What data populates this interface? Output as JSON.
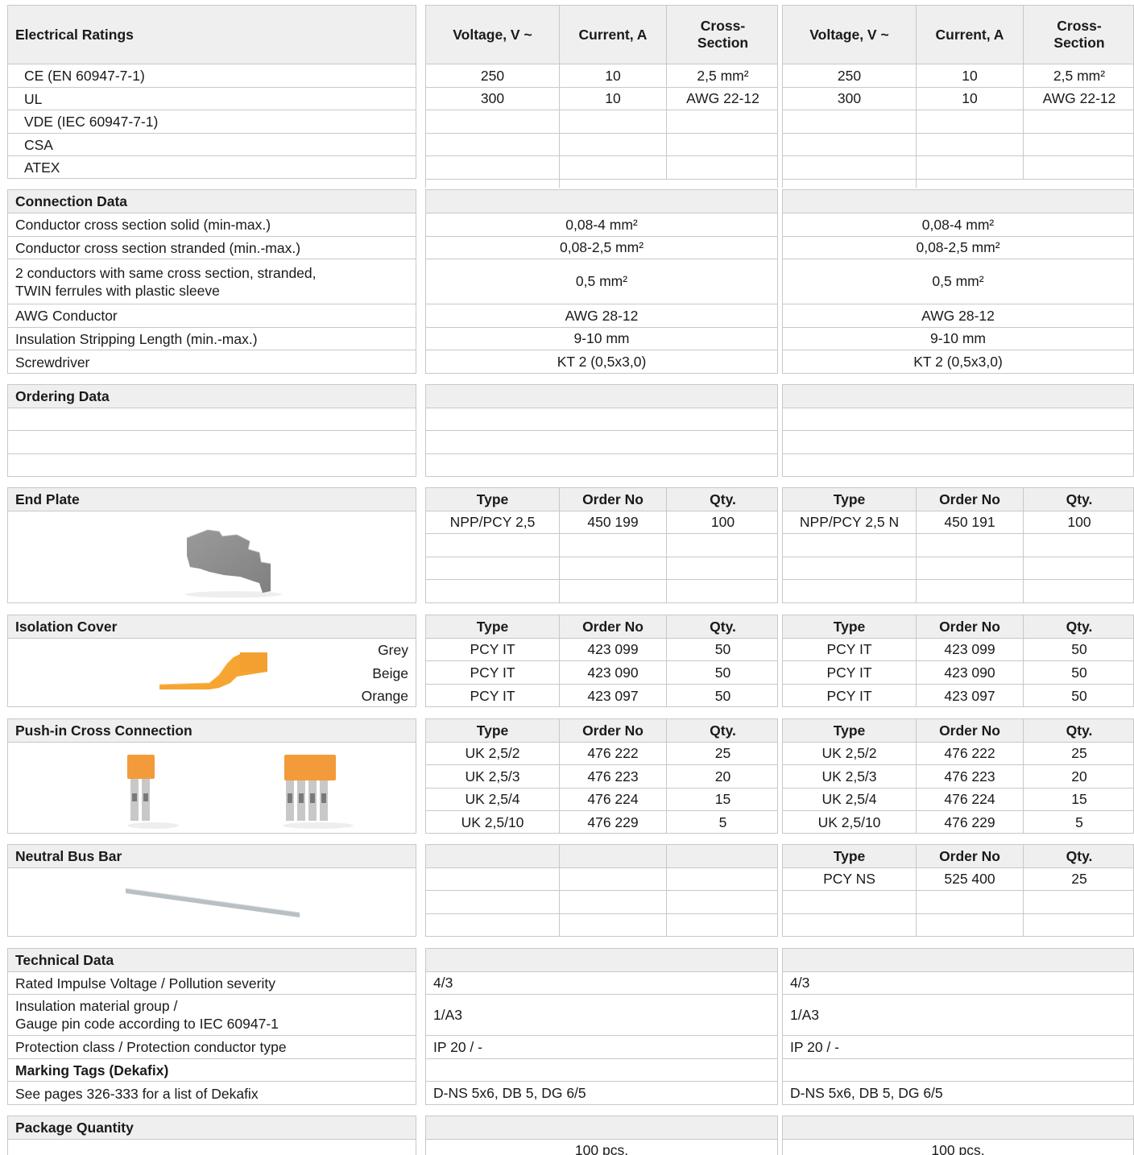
{
  "electrical": {
    "title": "Electrical Ratings",
    "cols": [
      "Voltage, V ~",
      "Current, A",
      "Cross-\nSection"
    ],
    "rows": [
      "CE (EN 60947-7-1)",
      "UL",
      "VDE (IEC 60947-7-1)",
      "CSA",
      "ATEX"
    ],
    "left_values": [
      [
        "250",
        "10",
        "2,5 mm²"
      ],
      [
        "300",
        "10",
        "AWG 22-12"
      ]
    ],
    "right_values": [
      [
        "250",
        "10",
        "2,5 mm²"
      ],
      [
        "300",
        "10",
        "AWG 22-12"
      ]
    ]
  },
  "connection": {
    "title": "Connection Data",
    "rows": [
      {
        "label": "Conductor cross section solid (min-max.)",
        "left": "0,08-4 mm²",
        "right": "0,08-4 mm²"
      },
      {
        "label": "Conductor cross section stranded (min.-max.)",
        "left": "0,08-2,5 mm²",
        "right": "0,08-2,5 mm²"
      },
      {
        "label": "2 conductors with same cross section, stranded,\nTWIN ferrules with plastic sleeve",
        "left": "0,5 mm²",
        "right": "0,5 mm²"
      },
      {
        "label": "AWG Conductor",
        "left": "AWG 28-12",
        "right": "AWG 28-12"
      },
      {
        "label": "Insulation Stripping Length (min.-max.)",
        "left": "9-10 mm",
        "right": "9-10 mm"
      },
      {
        "label": "Screwdriver",
        "left": "KT 2 (0,5x3,0)",
        "right": "KT 2 (0,5x3,0)"
      }
    ]
  },
  "ordering": {
    "title": "Ordering Data"
  },
  "table_cols": [
    "Type",
    "Order No",
    "Qty."
  ],
  "end_plate": {
    "title": "End Plate",
    "left": [
      [
        "NPP/PCY 2,5",
        "450 199",
        "100"
      ]
    ],
    "right": [
      [
        "NPP/PCY 2,5 N",
        "450 191",
        "100"
      ]
    ]
  },
  "isolation": {
    "title": "Isolation Cover",
    "colors": [
      "Grey",
      "Beige",
      "Orange"
    ],
    "left": [
      [
        "PCY IT",
        "423 099",
        "50"
      ],
      [
        "PCY IT",
        "423 090",
        "50"
      ],
      [
        "PCY IT",
        "423 097",
        "50"
      ]
    ],
    "right": [
      [
        "PCY IT",
        "423 099",
        "50"
      ],
      [
        "PCY IT",
        "423 090",
        "50"
      ],
      [
        "PCY IT",
        "423 097",
        "50"
      ]
    ]
  },
  "pushin": {
    "title": "Push-in Cross Connection",
    "left": [
      [
        "UK 2,5/2",
        "476 222",
        "25"
      ],
      [
        "UK 2,5/3",
        "476 223",
        "20"
      ],
      [
        "UK 2,5/4",
        "476 224",
        "15"
      ],
      [
        "UK 2,5/10",
        "476 229",
        "5"
      ]
    ],
    "right": [
      [
        "UK 2,5/2",
        "476 222",
        "25"
      ],
      [
        "UK 2,5/3",
        "476 223",
        "20"
      ],
      [
        "UK 2,5/4",
        "476 224",
        "15"
      ],
      [
        "UK 2,5/10",
        "476 229",
        "5"
      ]
    ]
  },
  "neutral": {
    "title": "Neutral Bus Bar",
    "right": [
      [
        "PCY NS",
        "525 400",
        "25"
      ]
    ]
  },
  "technical": {
    "title": "Technical Data",
    "rows": [
      {
        "label": "Rated Impulse Voltage / Pollution severity",
        "left": "4/3",
        "right": "4/3"
      },
      {
        "label": "Insulation material group /\nGauge pin code according to IEC 60947-1",
        "left": "1/A3",
        "right": "1/A3"
      },
      {
        "label": "Protection class / Protection conductor type",
        "left": "IP 20 / -",
        "right": "IP 20 / -"
      }
    ],
    "marking_title": "Marking Tags (Dekafix)",
    "marking_label": "See pages 326-333 for a list of Dekafix",
    "marking_left": "D-NS 5x6, DB 5, DG 6/5",
    "marking_right": "D-NS 5x6, DB 5, DG 6/5"
  },
  "package": {
    "title": "Package Quantity",
    "left": "100 pcs.",
    "right": "100 pcs."
  }
}
